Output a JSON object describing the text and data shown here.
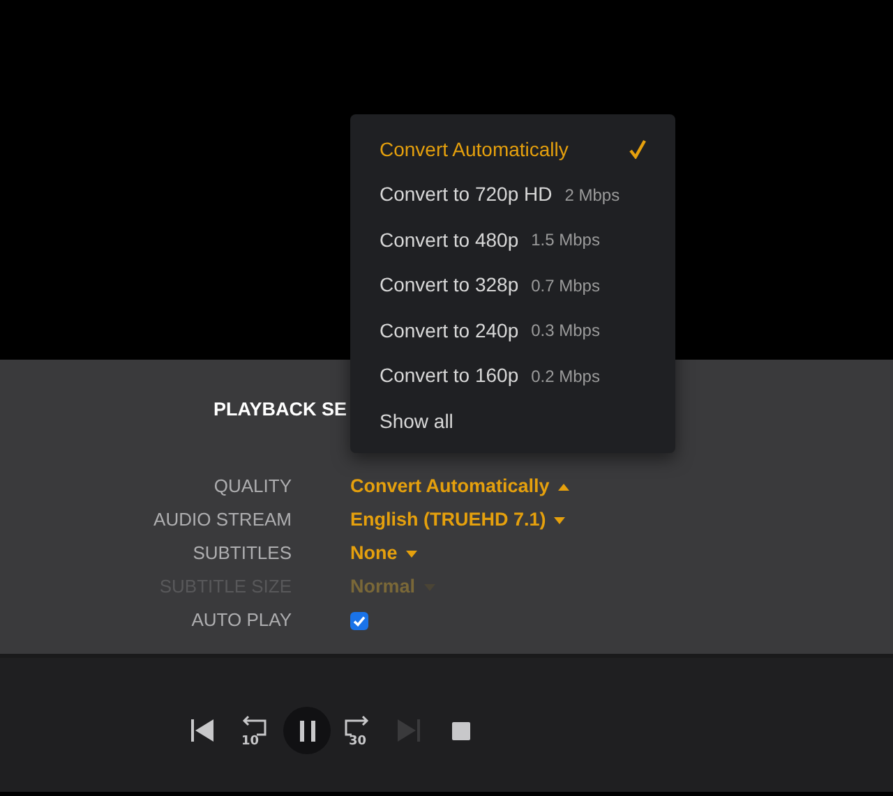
{
  "panel_title": "PLAYBACK SE",
  "settings": [
    {
      "kind": "dropdown",
      "label": "QUALITY",
      "value": "Convert Automatically",
      "expanded": true,
      "disabled": false
    },
    {
      "kind": "dropdown",
      "label": "AUDIO STREAM",
      "value": "English (TRUEHD 7.1)",
      "expanded": false,
      "disabled": false
    },
    {
      "kind": "dropdown",
      "label": "SUBTITLES",
      "value": "None",
      "expanded": false,
      "disabled": false
    },
    {
      "kind": "dropdown",
      "label": "SUBTITLE SIZE",
      "value": "Normal",
      "expanded": false,
      "disabled": true
    },
    {
      "kind": "checkbox",
      "label": "AUTO PLAY",
      "checked": true,
      "disabled": false
    }
  ],
  "quality_menu": [
    {
      "label": "Convert Automatically",
      "selected": true
    },
    {
      "label": "Convert to 720p HD",
      "bitrate": "2 Mbps",
      "selected": false
    },
    {
      "label": "Convert to 480p",
      "bitrate": "1.5 Mbps",
      "selected": false
    },
    {
      "label": "Convert to 328p",
      "bitrate": "0.7 Mbps",
      "selected": false
    },
    {
      "label": "Convert to 240p",
      "bitrate": "0.3 Mbps",
      "selected": false
    },
    {
      "label": "Convert to 160p",
      "bitrate": "0.2 Mbps",
      "selected": false
    },
    {
      "label": "Show all",
      "selected": false
    }
  ],
  "controls": [
    {
      "kind": "previous",
      "disabled": false
    },
    {
      "kind": "rewind",
      "label": "10",
      "disabled": false
    },
    {
      "kind": "pause",
      "disabled": false
    },
    {
      "kind": "forward",
      "label": "30",
      "disabled": false
    },
    {
      "kind": "next",
      "disabled": true
    },
    {
      "kind": "stop",
      "disabled": false
    }
  ]
}
